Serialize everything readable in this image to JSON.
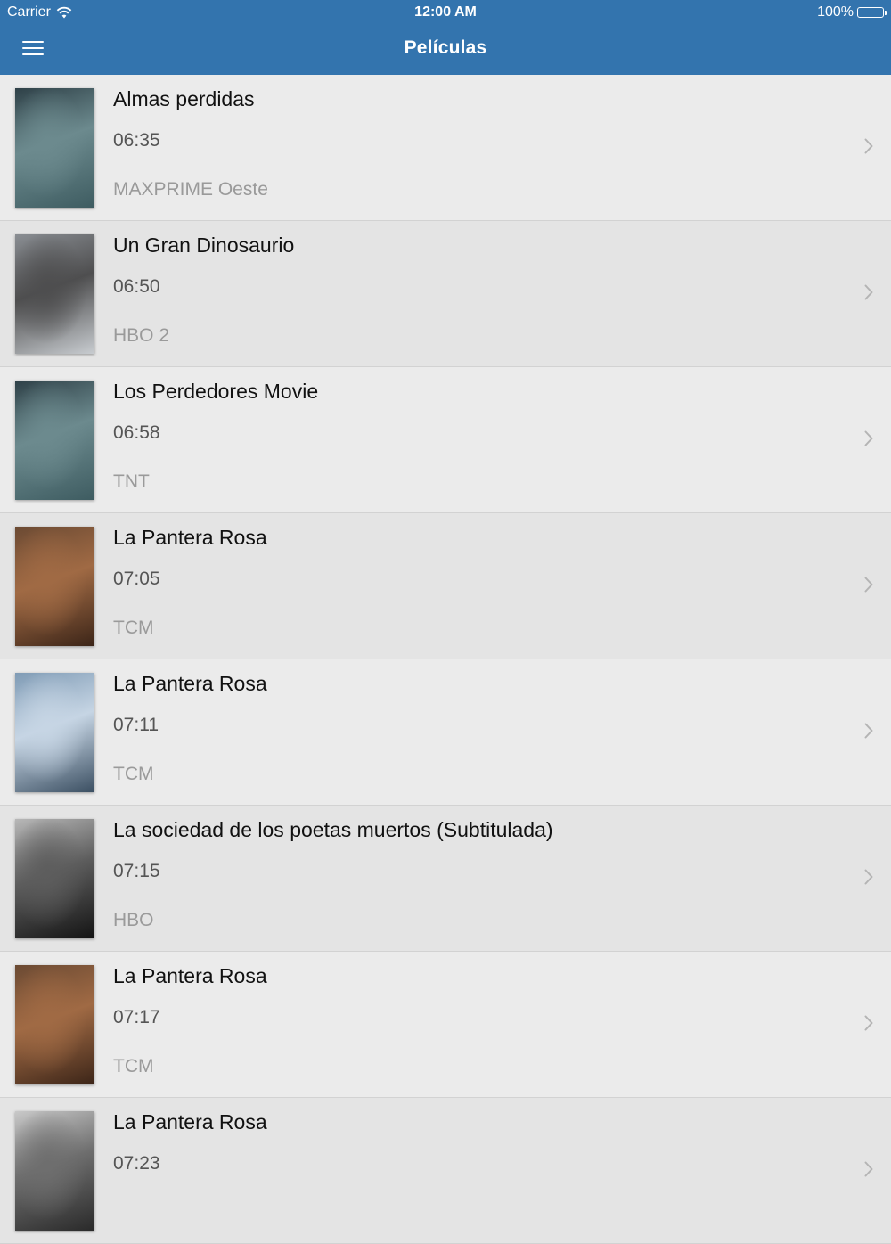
{
  "status_bar": {
    "carrier": "Carrier",
    "time": "12:00 AM",
    "battery": "100%"
  },
  "nav": {
    "title": "Películas",
    "menu_icon": "hamburger-menu-icon"
  },
  "colors": {
    "nav_background": "#3374ae",
    "list_background": "#e9e9e9"
  },
  "movies": [
    {
      "title": "Almas perdidas",
      "time": "06:35",
      "channel": "MAXPRIME Oeste",
      "poster_colors": [
        "#2e4047",
        "#6c8a8e",
        "#3e5c61"
      ]
    },
    {
      "title": "Un Gran Dinosaurio",
      "time": "06:50",
      "channel": "HBO 2",
      "poster_colors": [
        "#8a8e93",
        "#4e4e4f",
        "#c8ccd0"
      ]
    },
    {
      "title": "Los Perdedores Movie",
      "time": "06:58",
      "channel": "TNT",
      "poster_colors": [
        "#2e4047",
        "#6c8a8e",
        "#3e5c61"
      ]
    },
    {
      "title": "La Pantera Rosa",
      "time": "07:05",
      "channel": "TCM",
      "poster_colors": [
        "#6b4a33",
        "#a06a44",
        "#3c2518"
      ]
    },
    {
      "title": "La Pantera Rosa",
      "time": "07:11",
      "channel": "TCM",
      "poster_colors": [
        "#7f9bb5",
        "#c6d5e4",
        "#3b4f62"
      ]
    },
    {
      "title": "La sociedad de los poetas muertos (Subtitulada)",
      "time": "07:15",
      "channel": "HBO",
      "poster_colors": [
        "#b8b8b8",
        "#5d5d5d",
        "#141414"
      ]
    },
    {
      "title": "La Pantera Rosa",
      "time": "07:17",
      "channel": "TCM",
      "poster_colors": [
        "#6b4a33",
        "#a06a44",
        "#3c2518"
      ]
    },
    {
      "title": "La Pantera Rosa",
      "time": "07:23",
      "channel": "",
      "poster_colors": [
        "#c9c9c9",
        "#6e6e6e",
        "#2a2a2a"
      ]
    }
  ]
}
